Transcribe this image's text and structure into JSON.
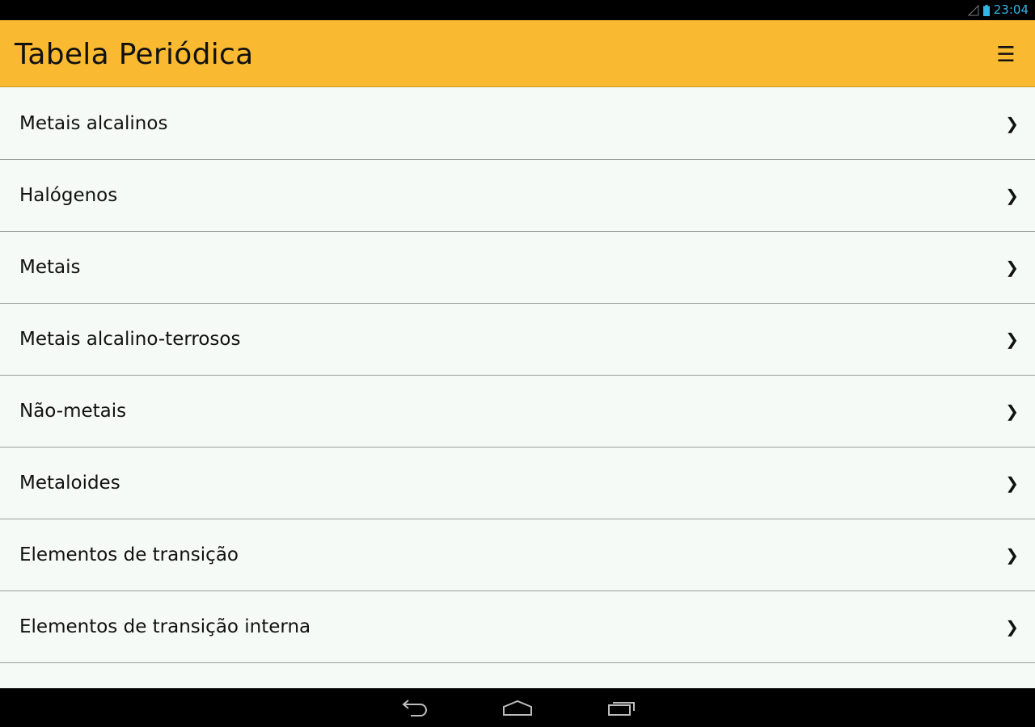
{
  "status_bar": {
    "time": "23:04",
    "signal_icon": "signal-icon",
    "battery_icon": "battery-icon",
    "accent_color": "#33b5e5"
  },
  "action_bar": {
    "title": "Tabela Periódica",
    "menu_icon_glyph": "☰",
    "background_color": "#f9b930"
  },
  "list": {
    "items": [
      {
        "label": "Metais alcalinos",
        "chevron": "❯"
      },
      {
        "label": "Halógenos",
        "chevron": "❯"
      },
      {
        "label": "Metais",
        "chevron": "❯"
      },
      {
        "label": "Metais alcalino-terrosos",
        "chevron": "❯"
      },
      {
        "label": "Não-metais",
        "chevron": "❯"
      },
      {
        "label": "Metaloides",
        "chevron": "❯"
      },
      {
        "label": "Elementos de transição",
        "chevron": "❯"
      },
      {
        "label": "Elementos de transição interna",
        "chevron": "❯"
      },
      {
        "label": "",
        "chevron": ""
      }
    ]
  },
  "nav_bar": {
    "back_icon": "back-icon",
    "home_icon": "home-icon",
    "recents_icon": "recents-icon"
  }
}
